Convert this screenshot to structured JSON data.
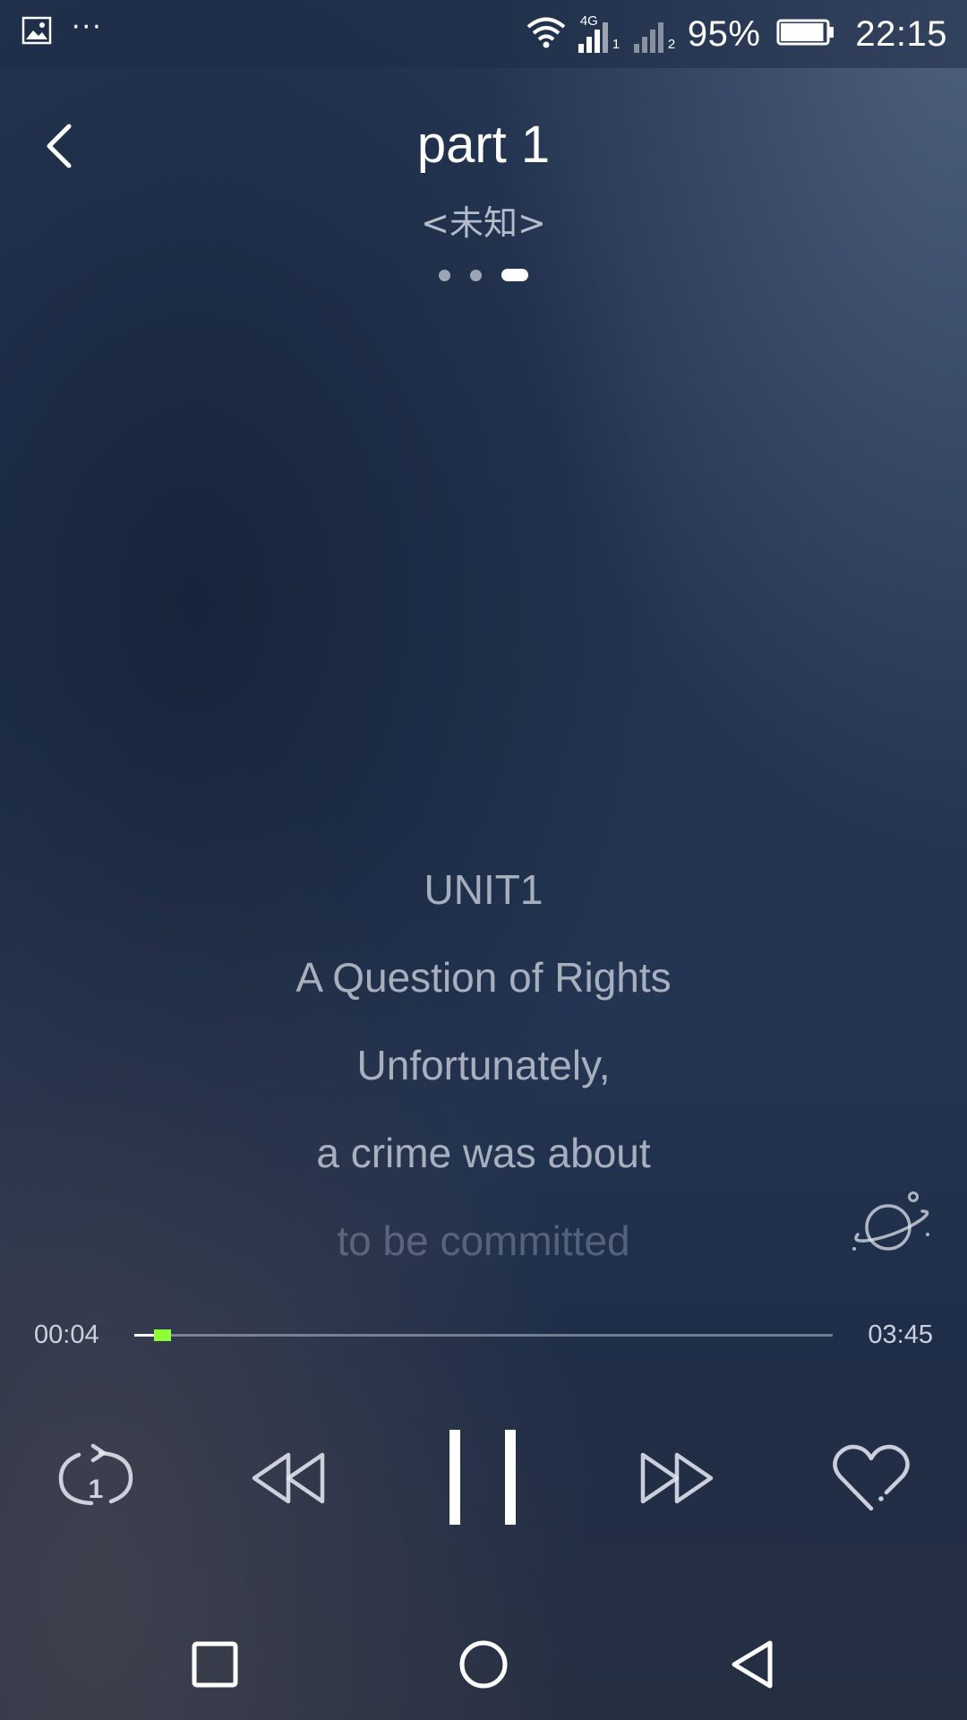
{
  "status_bar": {
    "notification_icons": [
      "image-icon",
      "more-dots-icon"
    ],
    "more_glyph": "···",
    "signal_sim1_label": "1",
    "signal_sim2_label": "2",
    "network_type": "4G",
    "battery_percent": "95%",
    "battery_level": 0.95,
    "time": "22:15"
  },
  "header": {
    "title": "part 1",
    "subtitle": "<未知>",
    "page_count": 3,
    "active_page": 3
  },
  "lyrics": {
    "lines": [
      "UNIT1",
      "A Question of Rights",
      "Unfortunately,",
      "a crime was about",
      "to be committed"
    ]
  },
  "progress": {
    "current_time": "00:04",
    "total_time": "03:45",
    "fraction": 0.018
  },
  "controls": {
    "repeat_mode_label": "1",
    "buttons": [
      "repeat-one-icon",
      "rewind-icon",
      "pause-icon",
      "fast-forward-icon",
      "heart-icon"
    ]
  },
  "colors": {
    "accent": "#8fff3a",
    "text_primary": "#ffffff"
  }
}
